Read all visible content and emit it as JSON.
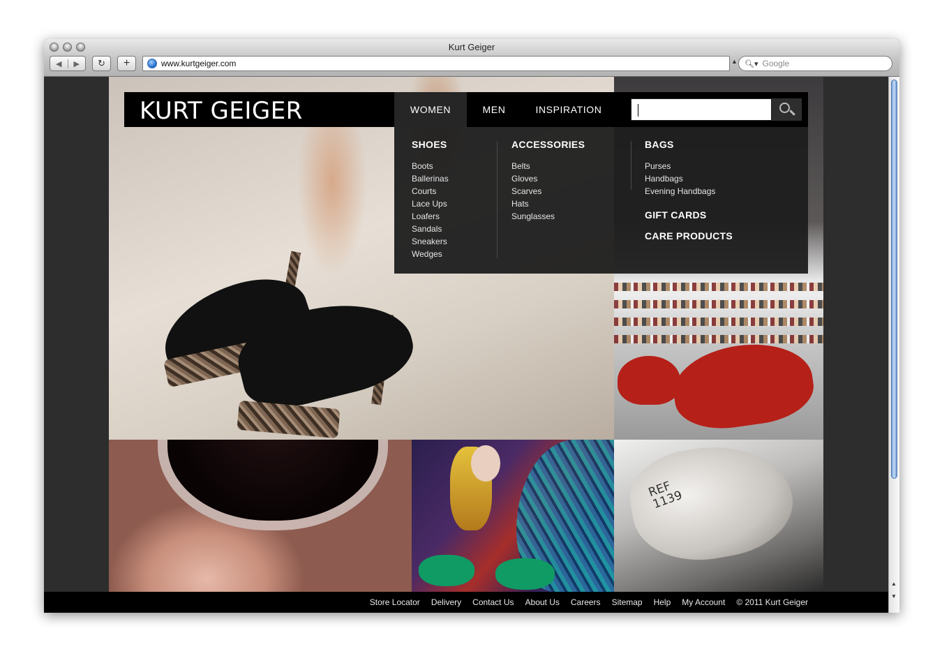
{
  "browser": {
    "window_title": "Kurt Geiger",
    "url": "www.kurtgeiger.com",
    "search_placeholder": "Google",
    "reload_symbol": "↻",
    "add_symbol": "+",
    "back_symbol": "◀",
    "forward_symbol": "▶"
  },
  "header": {
    "brand": "KURT GEIGER",
    "nav": [
      "WOMEN",
      "MEN",
      "INSPIRATION"
    ],
    "search_value": ""
  },
  "dropdown": {
    "shoes": {
      "title": "SHOES",
      "items": [
        "Boots",
        "Ballerinas",
        "Courts",
        "Lace Ups",
        "Loafers",
        "Sandals",
        "Sneakers",
        "Wedges"
      ]
    },
    "accessories": {
      "title": "ACCESSORIES",
      "items": [
        "Belts",
        "Gloves",
        "Scarves",
        "Hats",
        "Sunglasses"
      ]
    },
    "bags": {
      "title": "BAGS",
      "items": [
        "Purses",
        "Handbags",
        "Evening Handbags"
      ]
    },
    "gift_cards": "GIFT CARDS",
    "care_products": "CARE PRODUCTS"
  },
  "tiles": {
    "last_text": "REF\n1139"
  },
  "footer": {
    "links": [
      "Store Locator",
      "Delivery",
      "Contact Us",
      "About Us",
      "Careers",
      "Sitemap",
      "Help",
      "My Account"
    ],
    "copyright": "© 2011 Kurt Geiger"
  },
  "colors": {
    "page_bg": "#2d2d2d",
    "header_bg": "#000000",
    "active_nav_bg": "#262626"
  }
}
